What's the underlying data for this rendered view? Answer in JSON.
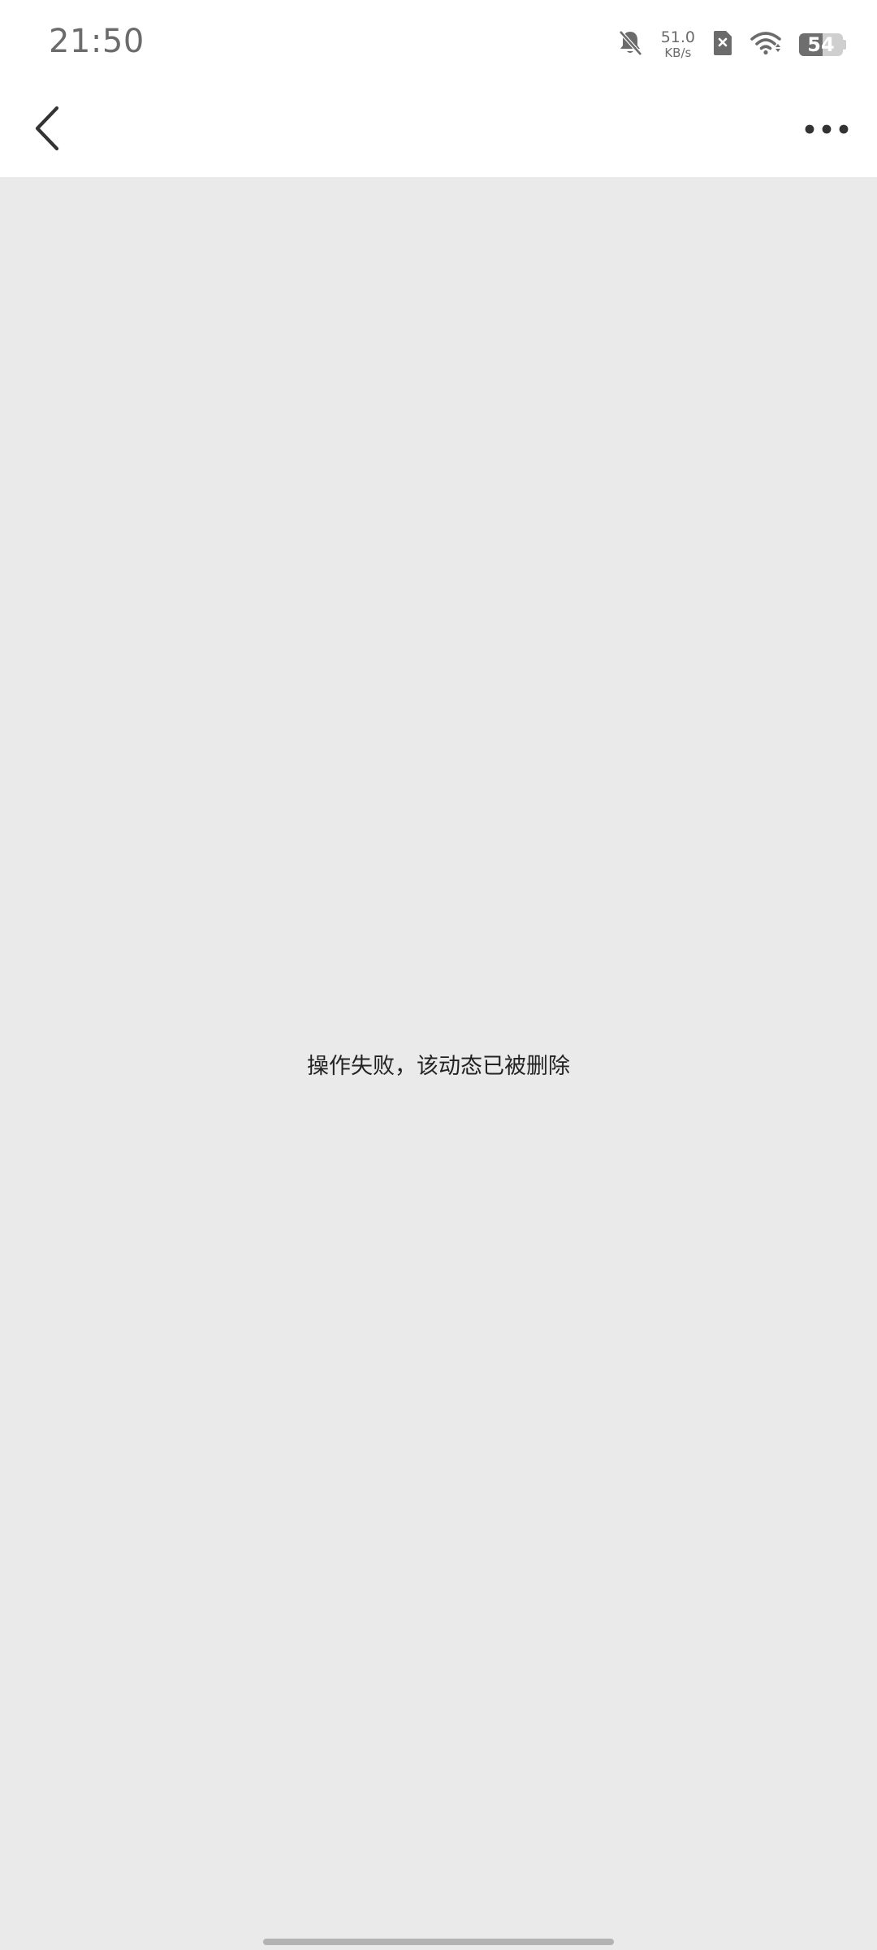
{
  "status_bar": {
    "time": "21:50",
    "net_speed_value": "51.0",
    "net_speed_unit": "KB/s",
    "battery_level": "54",
    "battery_fraction": 0.54,
    "icons": [
      "bell-off-icon",
      "sim-error-icon",
      "wifi-icon",
      "battery-icon"
    ]
  },
  "nav": {
    "back_icon": "chevron-left-icon",
    "more_icon": "more-horizontal-icon"
  },
  "content": {
    "message": "操作失败，该动态已被删除"
  },
  "colors": {
    "page_background": "#eaeaea",
    "header_background": "#ffffff",
    "status_text": "#6b6b6b",
    "icon_dark": "#333333",
    "message_text": "#222222"
  }
}
